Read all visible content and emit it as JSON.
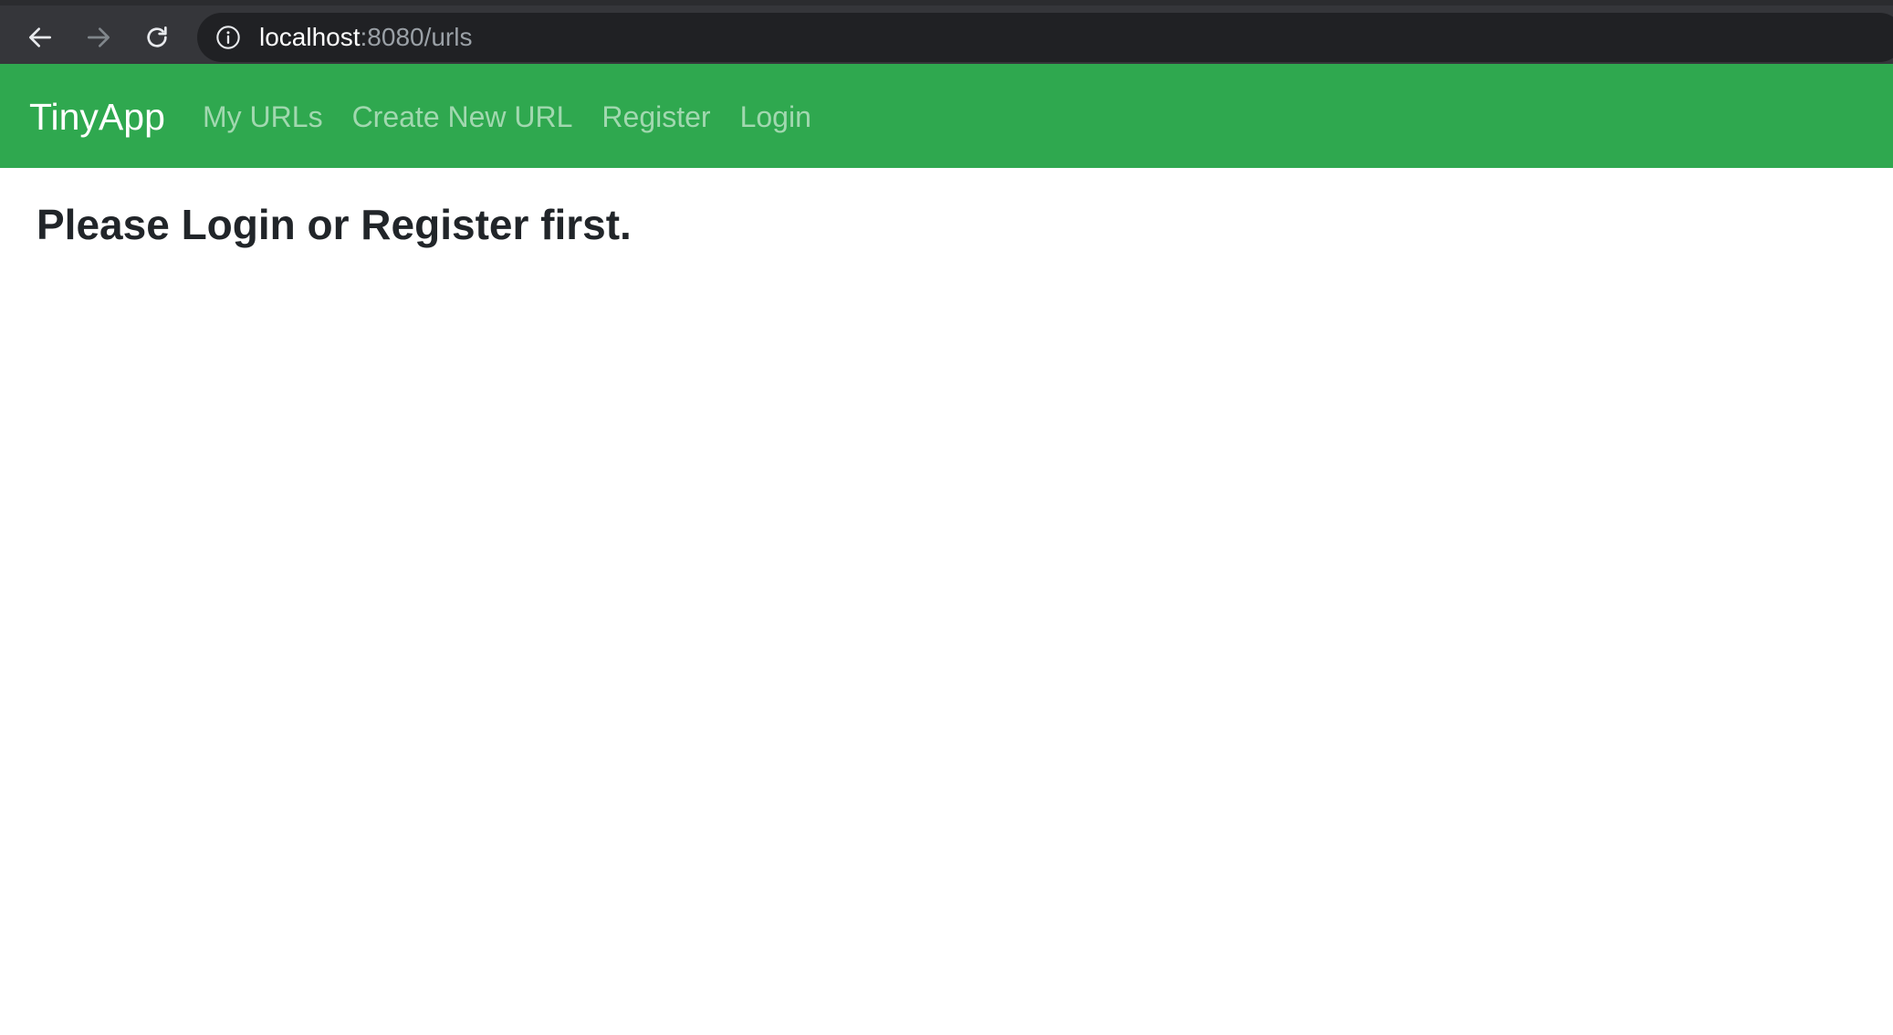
{
  "browser": {
    "url_host": "localhost",
    "url_rest": ":8080/urls",
    "icons": {
      "back": "back-arrow-icon",
      "forward": "forward-arrow-icon",
      "reload": "reload-icon",
      "info": "info-icon"
    }
  },
  "navbar": {
    "brand": "TinyApp",
    "links": [
      "My URLs",
      "Create New URL",
      "Register",
      "Login"
    ],
    "background_color": "#2fa84f"
  },
  "main": {
    "heading": "Please Login or Register first."
  }
}
